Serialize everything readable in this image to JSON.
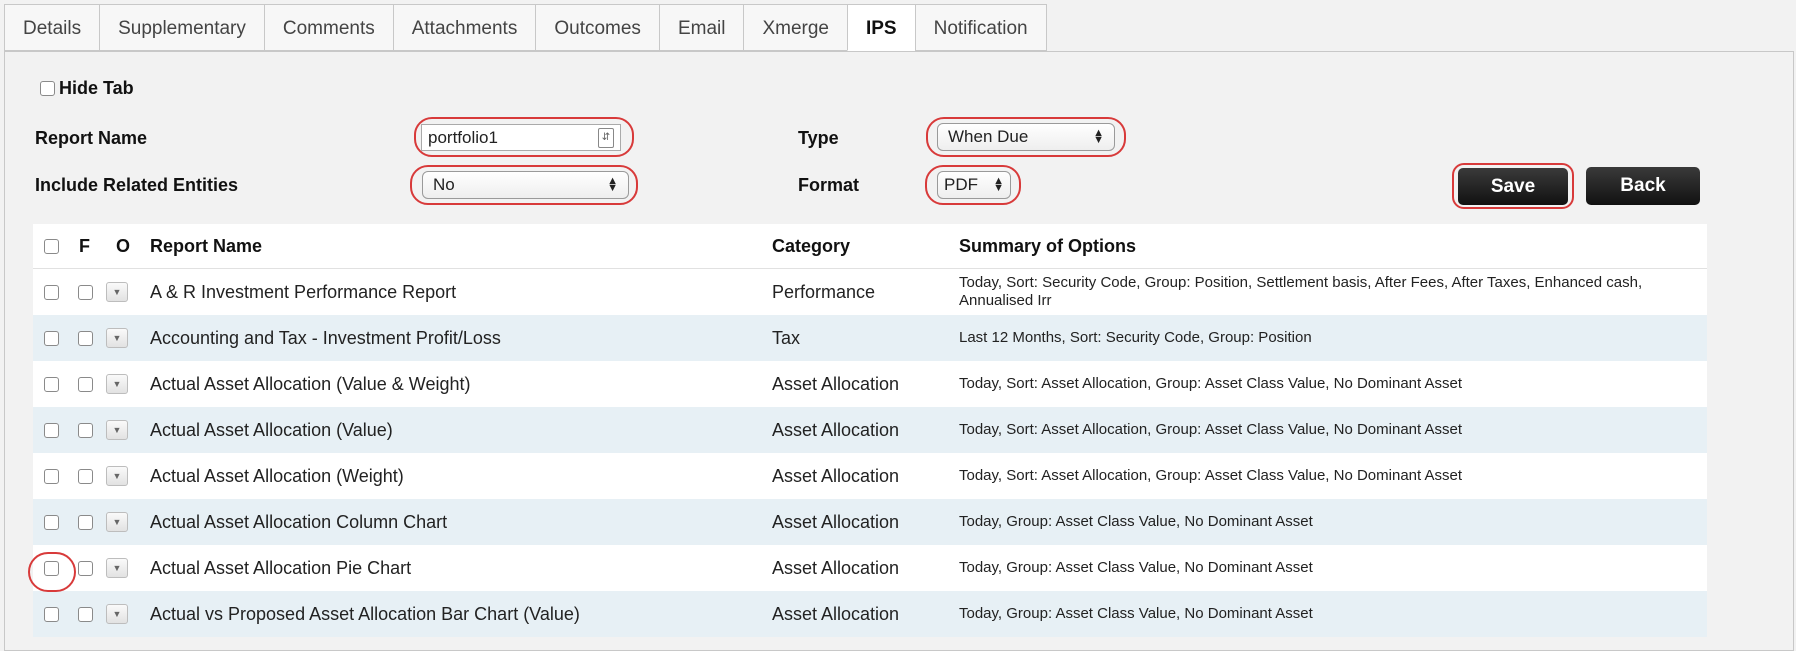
{
  "tabs": [
    {
      "label": "Details"
    },
    {
      "label": "Supplementary"
    },
    {
      "label": "Comments"
    },
    {
      "label": "Attachments"
    },
    {
      "label": "Outcomes"
    },
    {
      "label": "Email"
    },
    {
      "label": "Xmerge"
    },
    {
      "label": "IPS",
      "active": true
    },
    {
      "label": "Notification"
    }
  ],
  "form": {
    "hide_tab_label": "Hide Tab",
    "report_name_label": "Report Name",
    "report_name_value": "portfolio1",
    "include_related_label": "Include Related Entities",
    "include_related_value": "No",
    "type_label": "Type",
    "type_value": "When Due",
    "format_label": "Format",
    "format_value": "PDF",
    "save_label": "Save",
    "back_label": "Back"
  },
  "table": {
    "headers": {
      "f": "F",
      "o": "O",
      "report_name": "Report Name",
      "category": "Category",
      "summary": "Summary of Options"
    },
    "rows": [
      {
        "name": "A & R Investment Performance Report",
        "category": "Performance",
        "summary": "Today, Sort: Security Code, Group: Position, Settlement basis, After Fees, After Taxes, Enhanced cash, Annualised Irr"
      },
      {
        "name": "Accounting and Tax - Investment Profit/Loss",
        "category": "Tax",
        "summary": "Last 12 Months, Sort: Security Code, Group: Position"
      },
      {
        "name": "Actual Asset Allocation (Value & Weight)",
        "category": "Asset Allocation",
        "summary": "Today, Sort: Asset Allocation, Group: Asset Class Value, No Dominant Asset"
      },
      {
        "name": "Actual Asset Allocation (Value)",
        "category": "Asset Allocation",
        "summary": "Today, Sort: Asset Allocation, Group: Asset Class Value, No Dominant Asset"
      },
      {
        "name": "Actual Asset Allocation (Weight)",
        "category": "Asset Allocation",
        "summary": "Today, Sort: Asset Allocation, Group: Asset Class Value, No Dominant Asset"
      },
      {
        "name": "Actual Asset Allocation Column Chart",
        "category": "Asset Allocation",
        "summary": "Today, Group: Asset Class Value, No Dominant Asset"
      },
      {
        "name": "Actual Asset Allocation Pie Chart",
        "category": "Asset Allocation",
        "summary": "Today, Group: Asset Class Value, No Dominant Asset"
      },
      {
        "name": "Actual vs Proposed Asset Allocation Bar Chart (Value)",
        "category": "Asset Allocation",
        "summary": "Today, Group: Asset Class Value, No Dominant Asset"
      }
    ]
  },
  "colors": {
    "highlight": "#d83a3a",
    "row_alt": "#e7f0f5",
    "button": "#1a1a1a"
  }
}
